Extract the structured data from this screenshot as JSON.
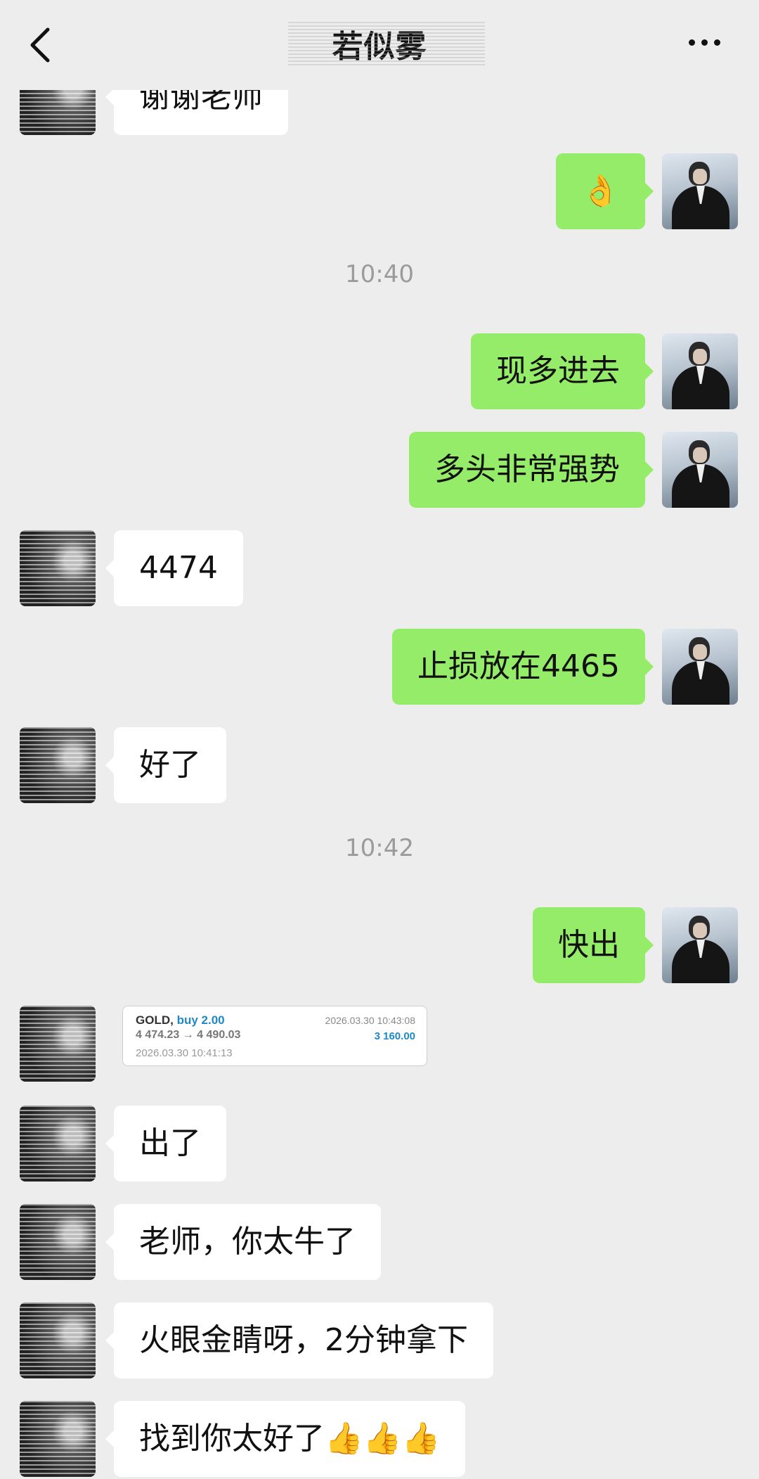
{
  "header": {
    "title": "若似雾",
    "back_icon": "back-arrow-icon",
    "more_icon": "more-dots-icon"
  },
  "timestamps": [
    "10:40",
    "10:42"
  ],
  "messages": [
    {
      "side": "other",
      "text": "谢谢老师"
    },
    {
      "side": "self",
      "text": "👌"
    },
    {
      "side": "self",
      "text": "现多进去"
    },
    {
      "side": "self",
      "text": "多头非常强势"
    },
    {
      "side": "other",
      "text": "4474"
    },
    {
      "side": "self",
      "text": "止损放在4465"
    },
    {
      "side": "other",
      "text": "好了"
    },
    {
      "side": "self",
      "text": "快出"
    },
    {
      "side": "other",
      "text": "出了"
    },
    {
      "side": "other",
      "text": "老师，你太牛了"
    },
    {
      "side": "other",
      "text": "火眼金睛呀，2分钟拿下"
    },
    {
      "side": "other",
      "text": "找到你太好了👍👍👍"
    }
  ],
  "trade_card": {
    "symbol": "GOLD,",
    "direction": "buy 2.00",
    "close_time": "2026.03.30 10:43:08",
    "prices": "4 474.23 → 4 490.03",
    "profit": "3 160.00",
    "open_time": "2026.03.30 10:41:13"
  },
  "colors": {
    "background": "#ededed",
    "self_bubble": "#95ec69",
    "other_bubble": "#ffffff",
    "timestamp": "#9b9b9b",
    "trade_accent": "#1e88c8"
  }
}
